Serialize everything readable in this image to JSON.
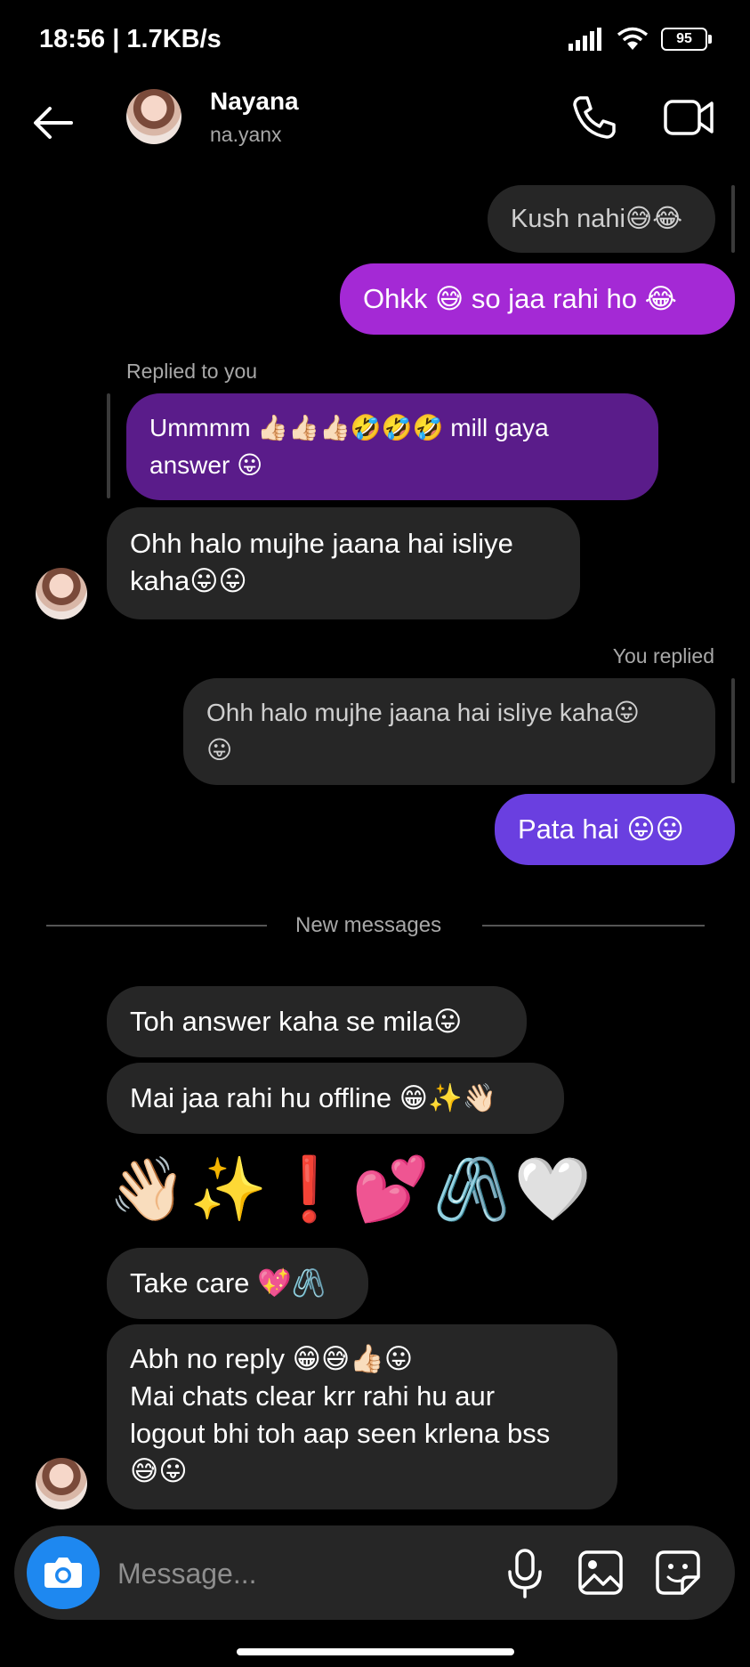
{
  "status_bar": {
    "time_speed": "18:56 | 1.7KB/s",
    "battery": "95"
  },
  "header": {
    "name": "Nayana",
    "handle": "na.yanx"
  },
  "messages": {
    "m1": "Kush nahi😅😂",
    "m2": "Ohkk 😅 so jaa rahi ho 😂",
    "replied_label": "Replied to you",
    "m3_quote_line1": "Ummmm 👍🏻👍🏻👍🏻🤣🤣🤣 mill gaya",
    "m3_quote_line2": "answer 😛",
    "m4_line1": "Ohh halo mujhe jaana hai isliye",
    "m4_line2": "kaha😛😛",
    "you_replied_label": "You replied",
    "m5_quote_line1": "Ohh halo mujhe jaana hai isliye kaha😛",
    "m5_quote_line2": "😛",
    "m6": "Pata hai 😛😛",
    "divider": "New messages",
    "m7": "Toh answer kaha se mila😛",
    "m8": "Mai jaa rahi hu offline 😁✨👋🏻",
    "m9": "👋🏻✨❗💕🖇️🤍",
    "m10": "Take care 💖🖇️",
    "m11_line1": "Abh no reply 😁😅👍🏻😛",
    "m11_line2": "Mai chats clear krr rahi hu aur",
    "m11_line3": "logout bhi toh aap seen krlena bss",
    "m11_line4": "😅😛"
  },
  "composer": {
    "placeholder": "Message..."
  },
  "colors": {
    "sent_purple": "#a429d5",
    "sent_indigo": "#6a3fe0",
    "received": "#262626",
    "camera_blue": "#1e88f0"
  },
  "icons": [
    "back-arrow-icon",
    "phone-icon",
    "video-camera-icon",
    "camera-icon",
    "microphone-icon",
    "gallery-icon",
    "sticker-icon"
  ]
}
